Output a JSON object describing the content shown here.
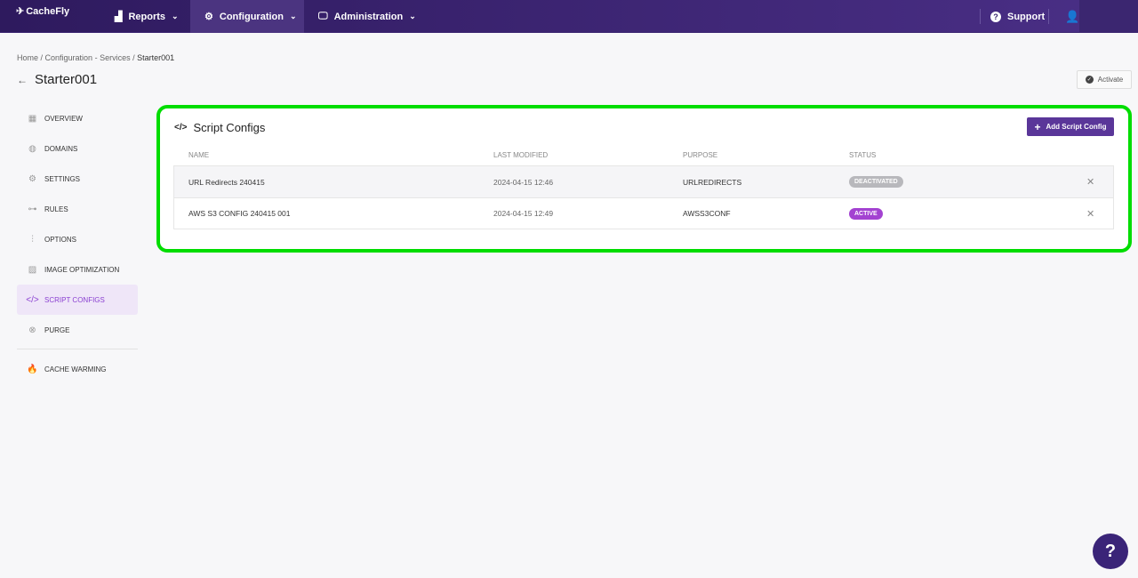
{
  "topbar": {
    "logo": "CacheFly",
    "nav": [
      {
        "label": "Reports",
        "icon": "chart-icon"
      },
      {
        "label": "Configuration",
        "icon": "gear-icon"
      },
      {
        "label": "Administration",
        "icon": "monitor-icon"
      }
    ],
    "support": "Support"
  },
  "breadcrumb": [
    "Home",
    "Configuration - Services",
    "Starter001"
  ],
  "page_title": "Starter001",
  "activate_label": "Activate",
  "sidebar": {
    "items": [
      {
        "label": "OVERVIEW",
        "icon": "overview-icon"
      },
      {
        "label": "DOMAINS",
        "icon": "globe-icon"
      },
      {
        "label": "SETTINGS",
        "icon": "gear-icon"
      },
      {
        "label": "RULES",
        "icon": "rules-icon"
      },
      {
        "label": "OPTIONS",
        "icon": "sliders-icon"
      },
      {
        "label": "IMAGE OPTIMIZATION",
        "icon": "image-icon"
      },
      {
        "label": "SCRIPT CONFIGS",
        "icon": "code-icon"
      },
      {
        "label": "PURGE",
        "icon": "purge-icon"
      }
    ],
    "extra": {
      "label": "CACHE WARMING",
      "icon": "flame-icon"
    }
  },
  "card": {
    "title": "Script Configs",
    "add_label": "Add Script Config",
    "columns": [
      "NAME",
      "LAST MODIFIED",
      "PURPOSE",
      "STATUS"
    ],
    "rows": [
      {
        "name": "URL Redirects 240415",
        "modified": "2024-04-15 12:46",
        "purpose": "URLREDIRECTS",
        "status": "DEACTIVATED"
      },
      {
        "name": "AWS S3 CONFIG 240415 001",
        "modified": "2024-04-15 12:49",
        "purpose": "AWSS3CONF",
        "status": "ACTIVE"
      }
    ]
  },
  "colors": {
    "accent": "#5a3699",
    "active": "#a342d1",
    "deactivated": "#b8b8bc",
    "highlight": "#00dd00"
  },
  "help": "?"
}
